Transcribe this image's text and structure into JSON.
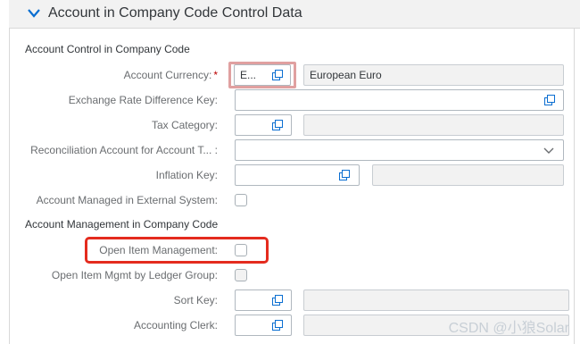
{
  "section": {
    "title": "Account in Company Code Control Data"
  },
  "groups": {
    "control": "Account Control in Company Code",
    "management": "Account Management in Company Code"
  },
  "fields": {
    "account_currency": {
      "label": "Account Currency:",
      "required": "*",
      "value": "E...",
      "description": "European Euro"
    },
    "exchange_rate_key": {
      "label": "Exchange Rate Difference Key:",
      "value": ""
    },
    "tax_category": {
      "label": "Tax Category:",
      "value": "",
      "description": ""
    },
    "reconciliation": {
      "label": "Reconciliation Account for Account T... :",
      "value": ""
    },
    "inflation_key": {
      "label": "Inflation Key:",
      "value": "",
      "description": ""
    },
    "managed_external": {
      "label": "Account Managed in External System:",
      "checked": false
    },
    "open_item_mgmt": {
      "label": "Open Item Management:",
      "checked": false
    },
    "open_item_ledger": {
      "label": "Open Item Mgmt by Ledger Group:",
      "checked": false
    },
    "sort_key": {
      "label": "Sort Key:",
      "value": "",
      "description": ""
    },
    "accounting_clerk": {
      "label": "Accounting Clerk:",
      "value": "",
      "description": ""
    }
  },
  "watermark": "CSDN @小狼Solar",
  "icons": {
    "collapse": "chevron-down-icon",
    "value_help": "value-help-icon",
    "dropdown": "chevron-down-icon"
  },
  "colors": {
    "highlight_pink": "#e0a0a0",
    "highlight_red": "#e42b1e",
    "required": "#bb0000"
  }
}
